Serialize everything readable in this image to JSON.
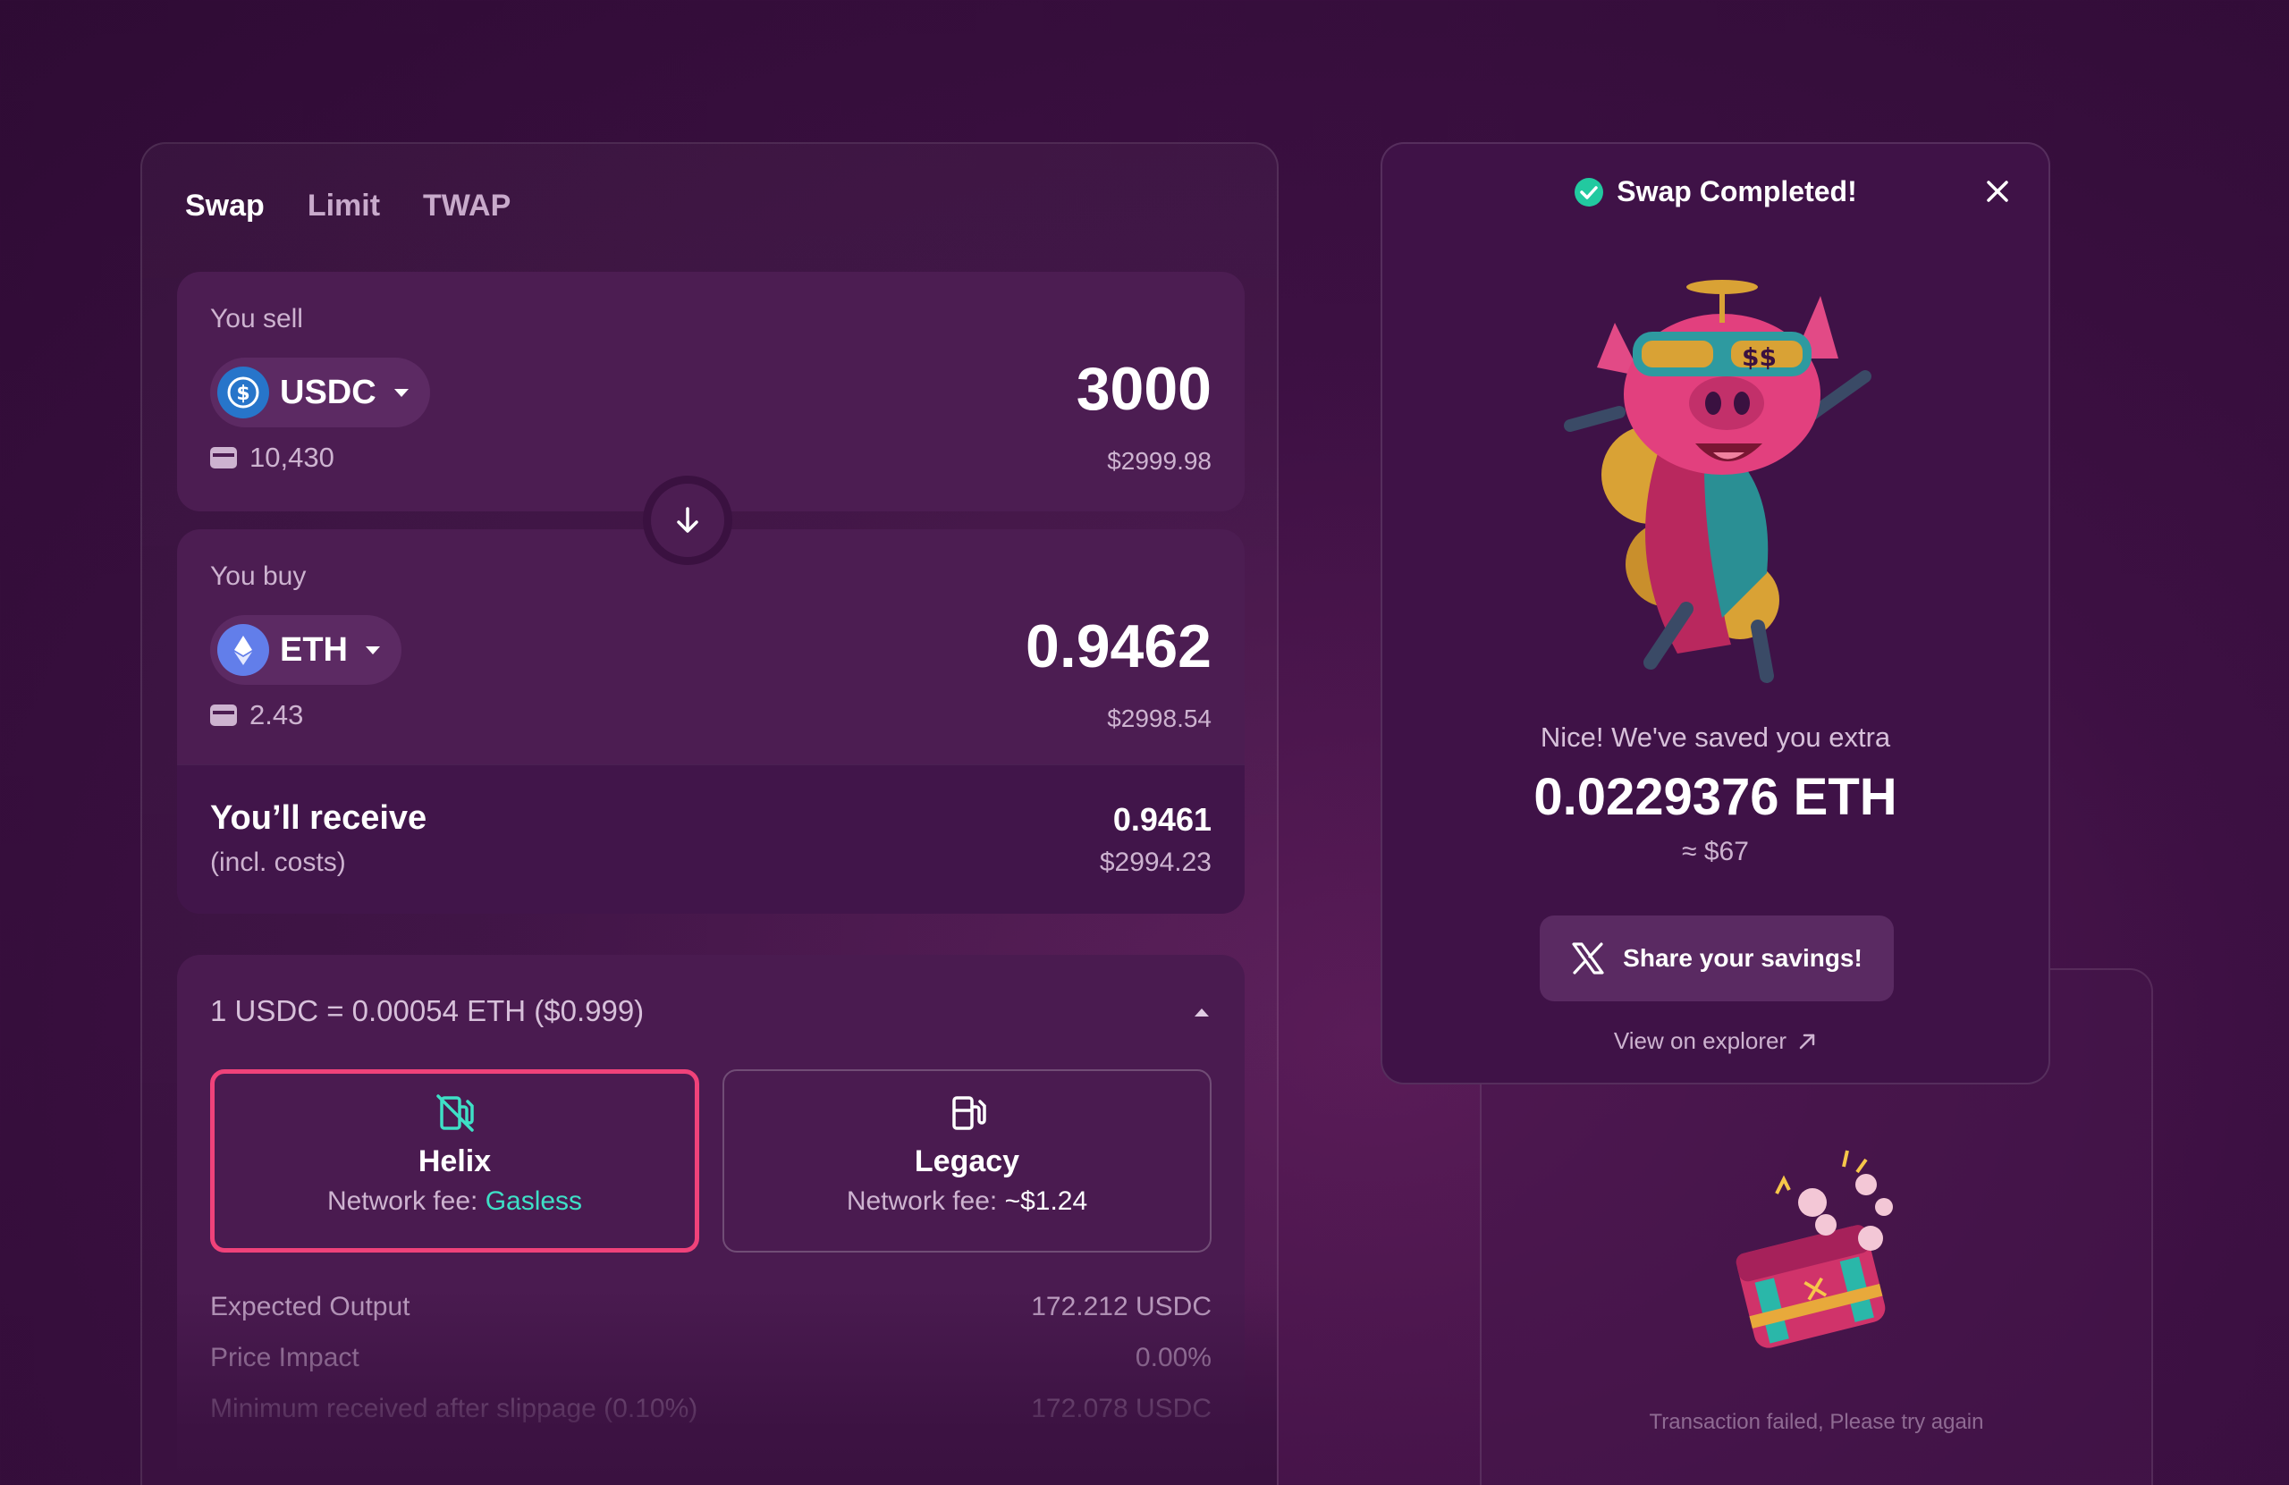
{
  "tabs": [
    "Swap",
    "Limit",
    "TWAP"
  ],
  "sell": {
    "label": "You sell",
    "token": "USDC",
    "amount": "3000",
    "usd": "$2999.98",
    "balance": "10,430"
  },
  "buy": {
    "label": "You buy",
    "token": "ETH",
    "amount": "0.9462",
    "usd": "$2998.54",
    "balance": "2.43"
  },
  "receive": {
    "title": "You’ll receive",
    "subtitle": "(incl. costs)",
    "amount": "0.9461",
    "usd": "$2994.23"
  },
  "details": {
    "rate": "1 USDC = 0.00054 ETH ($0.999)",
    "fee_options": [
      {
        "name": "Helix",
        "fee_label": "Network fee:",
        "fee_value": "Gasless"
      },
      {
        "name": "Legacy",
        "fee_label": "Network fee:",
        "fee_value": "~$1.24"
      }
    ],
    "rows": [
      {
        "label": "Expected Output",
        "value": "172.212 USDC"
      },
      {
        "label": "Price Impact",
        "value": "0.00%"
      },
      {
        "label": "Minimum received after slippage (0.10%)",
        "value": "172.078 USDC"
      }
    ]
  },
  "success": {
    "title": "Swap Completed!",
    "saved_line": "Nice! We've saved you extra",
    "saved_amount": "0.0229376 ETH",
    "saved_usd": "≈ $67",
    "share_label": "Share your savings!",
    "explorer_label": "View on explorer"
  },
  "failed": {
    "message": "Transaction failed, Please try again"
  },
  "colors": {
    "accent_pink": "#f0427a",
    "accent_teal": "#3ee0c6",
    "success_green": "#22c9a0",
    "usdc_blue": "#2775ca",
    "eth_blue": "#627eea"
  },
  "icons": {
    "usdc": "usdc-token-icon",
    "eth": "eth-token-icon",
    "wallet": "wallet-icon",
    "flip": "arrow-down-icon",
    "helix": "gasless-pump-icon",
    "legacy": "gas-pump-icon",
    "success": "check-circle-icon",
    "close": "close-icon",
    "share": "x-logo-icon",
    "explorer": "arrow-up-right-icon"
  }
}
